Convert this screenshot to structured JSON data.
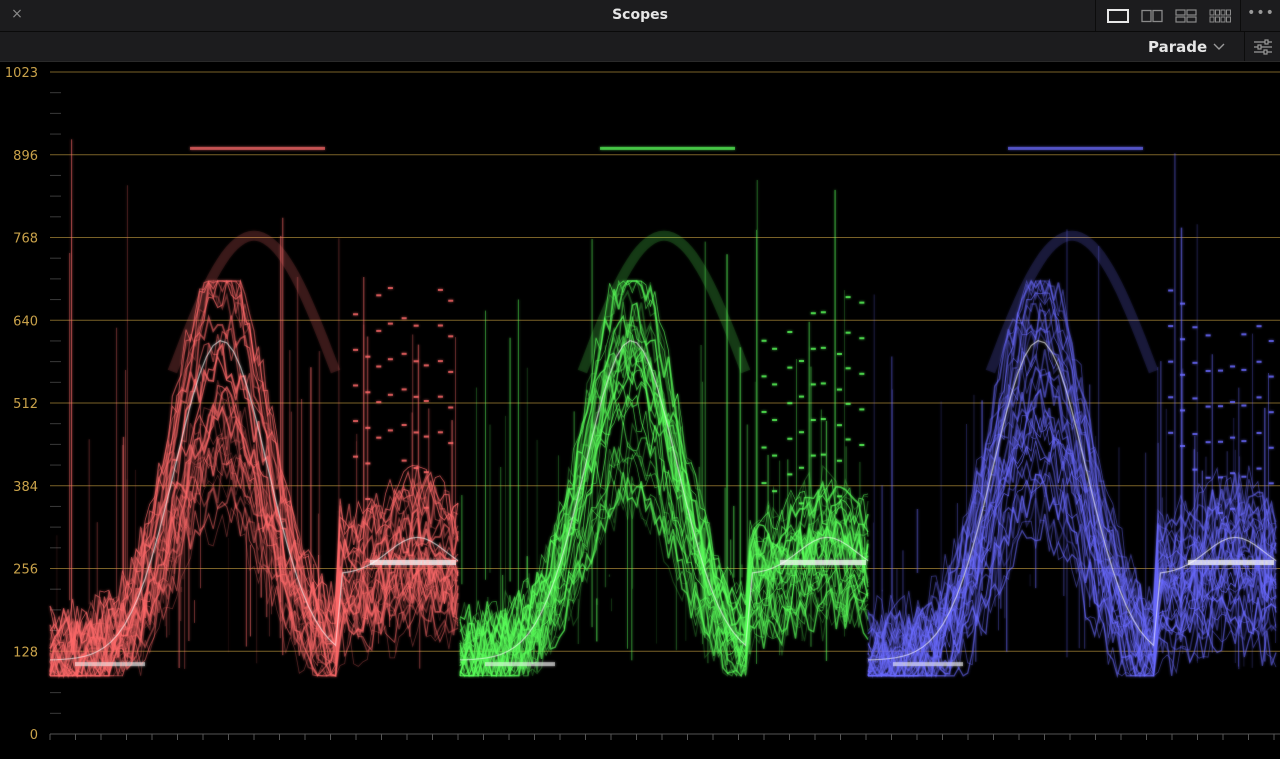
{
  "window": {
    "title": "Scopes",
    "close_glyph": "×",
    "more_glyph": "•••"
  },
  "toolbar": {
    "layouts": [
      {
        "name": "single-layout-icon",
        "selected": true
      },
      {
        "name": "dual-layout-icon",
        "selected": false
      },
      {
        "name": "quad-layout-icon",
        "selected": false
      },
      {
        "name": "eight-layout-icon",
        "selected": false
      }
    ],
    "mode": {
      "label": "Parade",
      "icon": "chevron-down-icon"
    },
    "settings_icon": "sliders-icon"
  },
  "scope": {
    "y_ticks": [
      "1023",
      "896",
      "768",
      "640",
      "512",
      "384",
      "256",
      "128",
      "0"
    ],
    "channels": [
      {
        "name": "red",
        "color": "#ff6a6a"
      },
      {
        "name": "green",
        "color": "#5aff5a"
      },
      {
        "name": "blue",
        "color": "#6a6aff"
      }
    ],
    "grid_color": "#7a6228",
    "label_color": "#c9a24a"
  }
}
